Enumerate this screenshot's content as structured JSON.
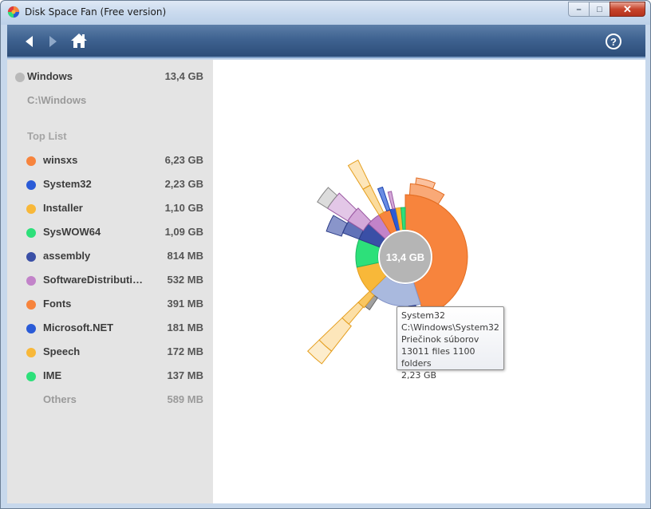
{
  "window": {
    "title": "Disk Space Fan (Free version)",
    "controls": {
      "minimize": "–",
      "maximize": "□",
      "close": "✕"
    }
  },
  "toolbar": {
    "back_icon": "back-arrow-icon",
    "forward_icon": "forward-arrow-icon",
    "home_icon": "home-icon",
    "help_label": "?"
  },
  "sidebar": {
    "root": {
      "name": "Windows",
      "size": "13,4 GB",
      "color": "#b9b9b9"
    },
    "path": "C:\\Windows",
    "section_title": "Top List",
    "items": [
      {
        "name": "winsxs",
        "size": "6,23 GB",
        "color": "#f7843d"
      },
      {
        "name": "System32",
        "size": "2,23 GB",
        "color": "#2a5bd7"
      },
      {
        "name": "Installer",
        "size": "1,10 GB",
        "color": "#f8b839"
      },
      {
        "name": "SysWOW64",
        "size": "1,09 GB",
        "color": "#2de07a"
      },
      {
        "name": "assembly",
        "size": "814 MB",
        "color": "#3a4fa6"
      },
      {
        "name": "SoftwareDistributi…",
        "size": "532 MB",
        "color": "#c283c9"
      },
      {
        "name": "Fonts",
        "size": "391 MB",
        "color": "#f7843d"
      },
      {
        "name": "Microsoft.NET",
        "size": "181 MB",
        "color": "#2a5bd7"
      },
      {
        "name": "Speech",
        "size": "172 MB",
        "color": "#f8b839"
      },
      {
        "name": "IME",
        "size": "137 MB",
        "color": "#2de07a"
      }
    ],
    "others": {
      "name": "Others",
      "size": "589 MB"
    }
  },
  "chart": {
    "center_label": "13,4 GB"
  },
  "tooltip": {
    "name": "System32",
    "path": "C:\\Windows\\System32",
    "type": "Priečinok súborov",
    "counts": "13011 files  1100 folders",
    "size": "2,23 GB"
  }
}
